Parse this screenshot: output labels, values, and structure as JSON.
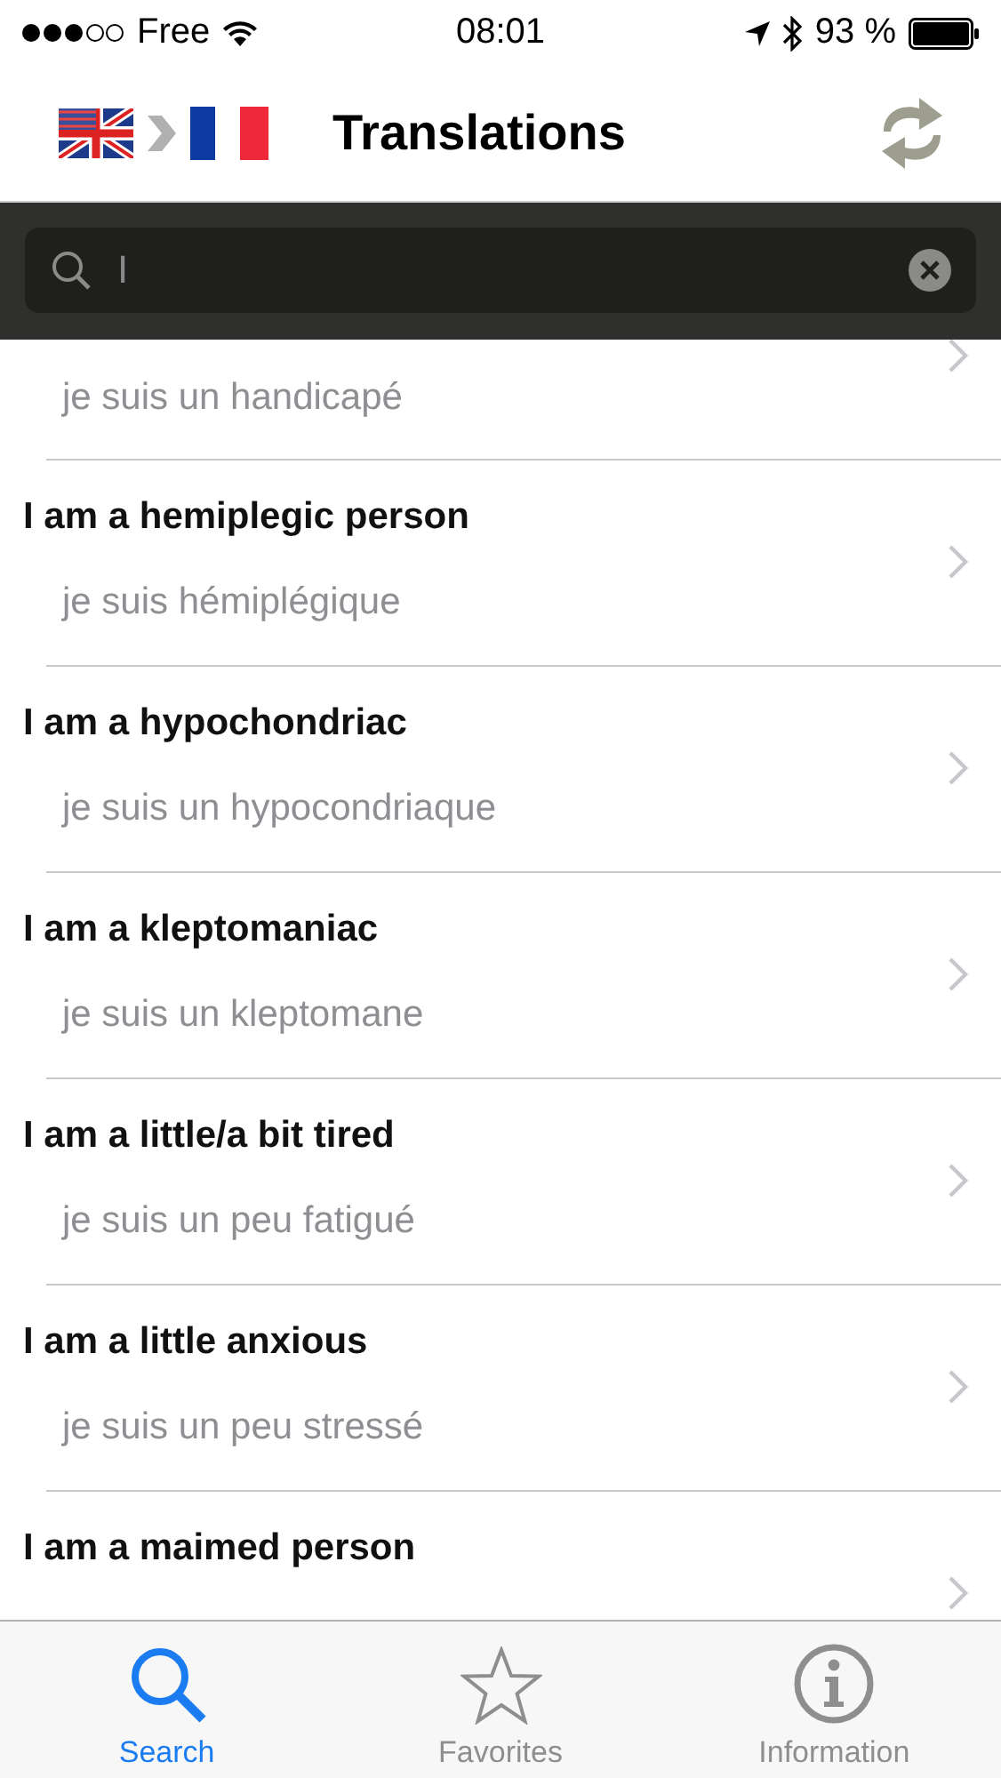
{
  "status_bar": {
    "carrier": "Free",
    "time": "08:01",
    "battery": "93 %"
  },
  "nav": {
    "title": "Translations"
  },
  "search": {
    "value": "I"
  },
  "rows": [
    {
      "translation": "je suis un handicapé"
    },
    {
      "english": "I am a hemiplegic person",
      "translation": "je suis hémiplégique"
    },
    {
      "english": "I am a hypochondriac",
      "translation": "je suis un hypocondriaque"
    },
    {
      "english": "I am a kleptomaniac",
      "translation": "je suis un kleptomane"
    },
    {
      "english": "I am a little/a bit tired",
      "translation": "je suis un peu fatigué"
    },
    {
      "english": "I am a little anxious",
      "translation": "je suis un peu stressé"
    },
    {
      "english": "I am a maimed person"
    }
  ],
  "tabs": [
    {
      "kind": "search",
      "label": "Search",
      "selected": true
    },
    {
      "kind": "favorites",
      "label": "Favorites",
      "selected": false
    },
    {
      "kind": "information",
      "label": "Information",
      "selected": false
    }
  ]
}
